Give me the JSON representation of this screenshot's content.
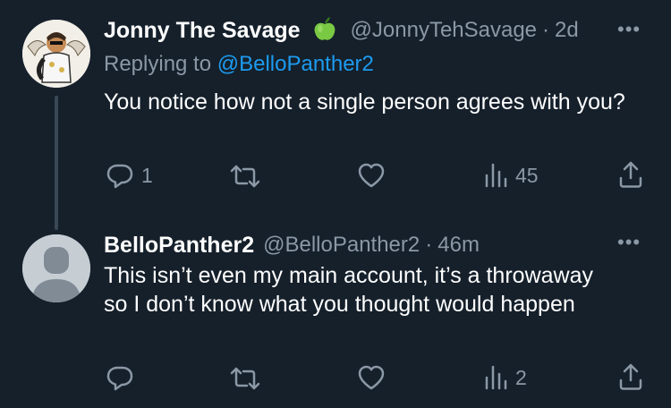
{
  "tweet1": {
    "display_name": "Jonny The Savage",
    "badge_icon": "green-apple-icon",
    "handle": "@JonnyTehSavage",
    "separator": "·",
    "time": "2d",
    "replying_prefix": "Replying to",
    "replying_to": "@BelloPanther2",
    "text": "You notice how not a single person agrees with you?",
    "actions": {
      "reply_count": "1",
      "retweet_count": "",
      "like_count": "",
      "views_count": "45"
    }
  },
  "tweet2": {
    "display_name": "BelloPanther2",
    "handle": "@BelloPanther2",
    "separator": "·",
    "time": "46m",
    "text": "This isn’t even my main account, it’s a throwaway so I don’t know what you thought would happen",
    "actions": {
      "reply_count": "",
      "retweet_count": "",
      "like_count": "",
      "views_count": "2"
    }
  },
  "colors": {
    "background": "#15202b",
    "text": "#ffffff",
    "muted": "#8b98a5",
    "link": "#1d9bf0"
  }
}
